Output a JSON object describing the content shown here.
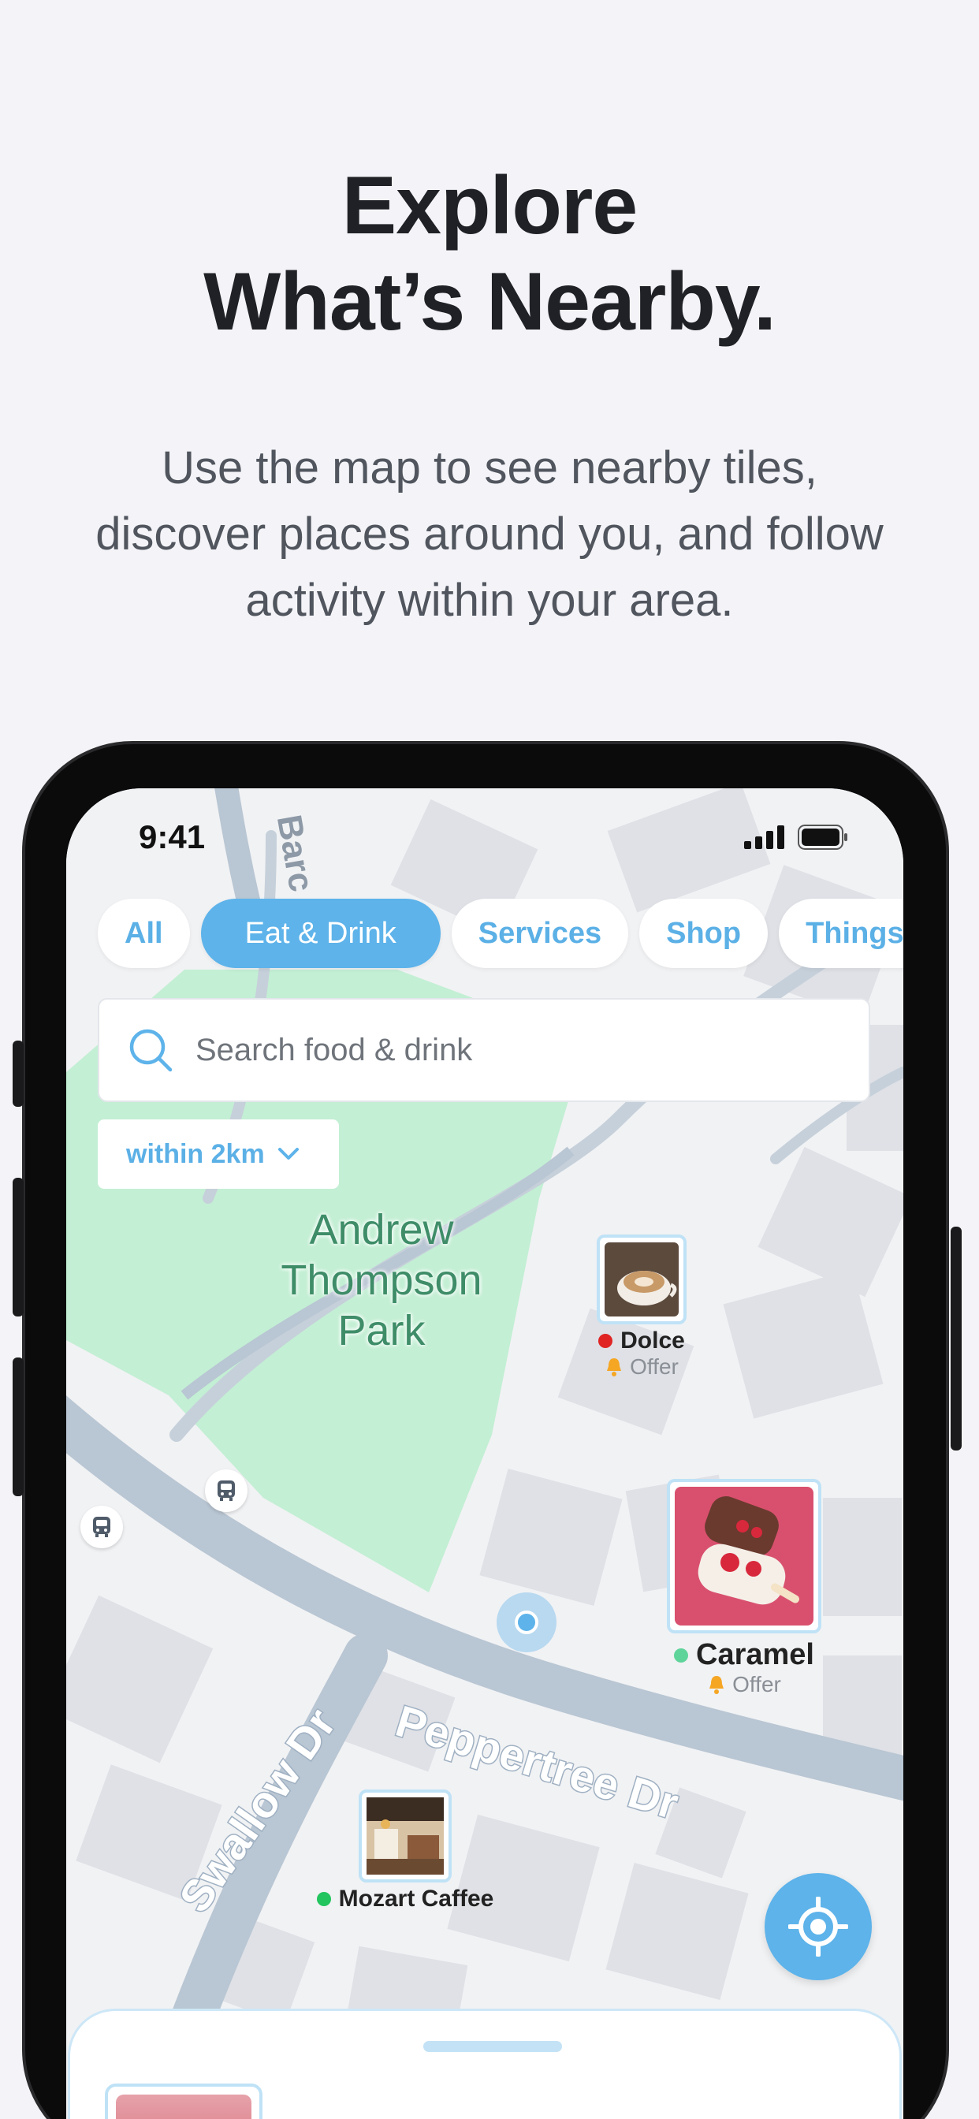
{
  "hero": {
    "title_line1": "Explore",
    "title_line2": "What’s Nearby.",
    "subtitle_line1": "Use the map to see nearby tiles,",
    "subtitle_line2": "discover places around you, and follow",
    "subtitle_line3": "activity within your area."
  },
  "status_bar": {
    "time": "9:41"
  },
  "categories": [
    {
      "label": "All",
      "active": false
    },
    {
      "label": "Eat & Drink",
      "active": true
    },
    {
      "label": "Services",
      "active": false
    },
    {
      "label": "Shop",
      "active": false
    },
    {
      "label": "Things to do",
      "active": false
    }
  ],
  "search": {
    "placeholder": "Search food & drink"
  },
  "radius_filter": {
    "label": "within 2km"
  },
  "map": {
    "park_label": "Andrew Thompson Park",
    "streets": {
      "peppertree": "Peppertree Dr",
      "swallow": "Swallow Dr",
      "top": "Barc"
    },
    "places": [
      {
        "name": "Dolce",
        "offer": "Offer",
        "status_color": "#e02424"
      },
      {
        "name": "Caramel",
        "offer": "Offer",
        "status_color": "#5fd49a"
      },
      {
        "name": "Mozart Caffee",
        "offer": "",
        "status_color": "#22c55e"
      }
    ]
  },
  "colors": {
    "accent": "#5db3ea",
    "park": "#c3efd4",
    "road": "#b9c6d3",
    "offer_bell": "#f5a623"
  }
}
